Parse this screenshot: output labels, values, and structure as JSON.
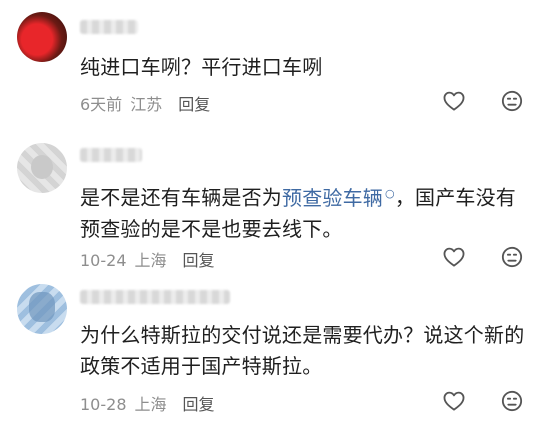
{
  "comments": [
    {
      "username": "",
      "text": "纯进口车咧？平行进口车咧",
      "time": "6天前",
      "location": "江苏",
      "reply": "回复"
    },
    {
      "username": "",
      "text_before": "是不是还有车辆是否为",
      "link": "预查验车辆",
      "text_after": "，国产车没有预查验的是不是也要去线下。",
      "time": "10-24",
      "location": "上海",
      "reply": "回复"
    },
    {
      "username": "",
      "text": "为什么特斯拉的交付说还是需要代办？说这个新的政策不适用于国产特斯拉。",
      "time": "10-28",
      "location": "上海",
      "reply": "回复"
    }
  ],
  "icons": {
    "like": "heart-outline-icon",
    "dislike": "sad-face-icon",
    "search": "search-icon"
  },
  "colors": {
    "text": "#1f1f1f",
    "meta": "#8e8e8e",
    "link": "#3f6aa3",
    "icon": "#555555"
  }
}
